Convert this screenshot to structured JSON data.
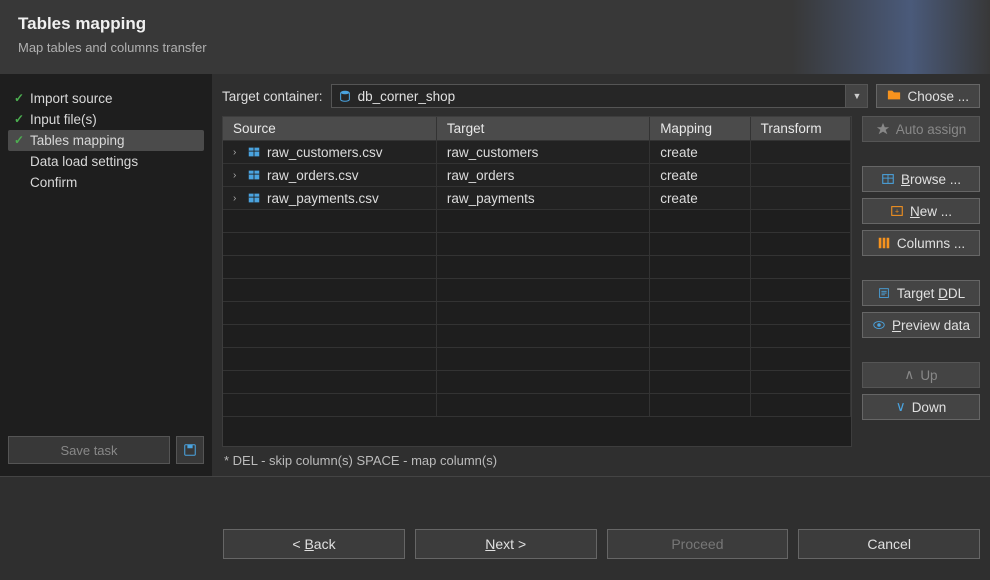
{
  "header": {
    "title": "Tables mapping",
    "subtitle": "Map tables and columns transfer"
  },
  "sidebar": {
    "steps": [
      {
        "label": "Import source",
        "done": true,
        "active": false
      },
      {
        "label": "Input file(s)",
        "done": true,
        "active": false
      },
      {
        "label": "Tables mapping",
        "done": true,
        "active": true
      },
      {
        "label": "Data load settings",
        "done": false,
        "active": false
      },
      {
        "label": "Confirm",
        "done": false,
        "active": false
      }
    ],
    "save_task_label": "Save task"
  },
  "target": {
    "label": "Target container:",
    "value": "db_corner_shop",
    "choose_label": "Choose ..."
  },
  "columns": {
    "source": "Source",
    "target": "Target",
    "mapping": "Mapping",
    "transform": "Transform"
  },
  "rows": [
    {
      "source": "raw_customers.csv",
      "target": "raw_customers",
      "mapping": "create",
      "transform": ""
    },
    {
      "source": "raw_orders.csv",
      "target": "raw_orders",
      "mapping": "create",
      "transform": ""
    },
    {
      "source": "raw_payments.csv",
      "target": "raw_payments",
      "mapping": "create",
      "transform": ""
    }
  ],
  "hint": "* DEL - skip column(s)  SPACE - map column(s)",
  "actions": {
    "auto_assign": "Auto assign",
    "browse": "Browse ...",
    "new": "New ...",
    "columns": "Columns ...",
    "target_ddl": "Target DDL",
    "preview": "Preview data",
    "up": "Up",
    "down": "Down"
  },
  "footer": {
    "back": "Back",
    "next": "Next >",
    "proceed": "Proceed",
    "cancel": "Cancel"
  }
}
